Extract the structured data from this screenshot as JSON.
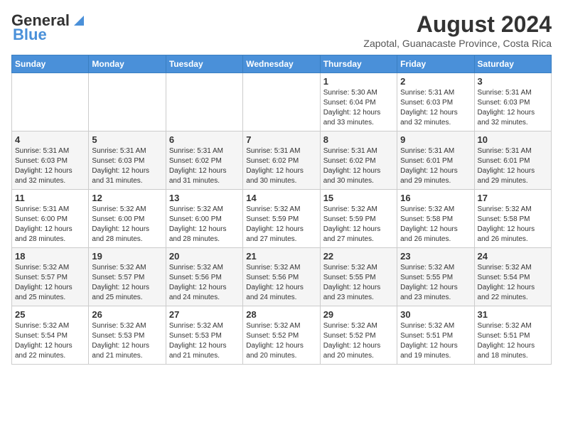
{
  "logo": {
    "line1": "General",
    "line2": "Blue"
  },
  "title": "August 2024",
  "subtitle": "Zapotal, Guanacaste Province, Costa Rica",
  "days_of_week": [
    "Sunday",
    "Monday",
    "Tuesday",
    "Wednesday",
    "Thursday",
    "Friday",
    "Saturday"
  ],
  "weeks": [
    [
      {
        "day": "",
        "info": ""
      },
      {
        "day": "",
        "info": ""
      },
      {
        "day": "",
        "info": ""
      },
      {
        "day": "",
        "info": ""
      },
      {
        "day": "1",
        "info": "Sunrise: 5:30 AM\nSunset: 6:04 PM\nDaylight: 12 hours\nand 33 minutes."
      },
      {
        "day": "2",
        "info": "Sunrise: 5:31 AM\nSunset: 6:03 PM\nDaylight: 12 hours\nand 32 minutes."
      },
      {
        "day": "3",
        "info": "Sunrise: 5:31 AM\nSunset: 6:03 PM\nDaylight: 12 hours\nand 32 minutes."
      }
    ],
    [
      {
        "day": "4",
        "info": "Sunrise: 5:31 AM\nSunset: 6:03 PM\nDaylight: 12 hours\nand 32 minutes."
      },
      {
        "day": "5",
        "info": "Sunrise: 5:31 AM\nSunset: 6:03 PM\nDaylight: 12 hours\nand 31 minutes."
      },
      {
        "day": "6",
        "info": "Sunrise: 5:31 AM\nSunset: 6:02 PM\nDaylight: 12 hours\nand 31 minutes."
      },
      {
        "day": "7",
        "info": "Sunrise: 5:31 AM\nSunset: 6:02 PM\nDaylight: 12 hours\nand 30 minutes."
      },
      {
        "day": "8",
        "info": "Sunrise: 5:31 AM\nSunset: 6:02 PM\nDaylight: 12 hours\nand 30 minutes."
      },
      {
        "day": "9",
        "info": "Sunrise: 5:31 AM\nSunset: 6:01 PM\nDaylight: 12 hours\nand 29 minutes."
      },
      {
        "day": "10",
        "info": "Sunrise: 5:31 AM\nSunset: 6:01 PM\nDaylight: 12 hours\nand 29 minutes."
      }
    ],
    [
      {
        "day": "11",
        "info": "Sunrise: 5:31 AM\nSunset: 6:00 PM\nDaylight: 12 hours\nand 28 minutes."
      },
      {
        "day": "12",
        "info": "Sunrise: 5:32 AM\nSunset: 6:00 PM\nDaylight: 12 hours\nand 28 minutes."
      },
      {
        "day": "13",
        "info": "Sunrise: 5:32 AM\nSunset: 6:00 PM\nDaylight: 12 hours\nand 28 minutes."
      },
      {
        "day": "14",
        "info": "Sunrise: 5:32 AM\nSunset: 5:59 PM\nDaylight: 12 hours\nand 27 minutes."
      },
      {
        "day": "15",
        "info": "Sunrise: 5:32 AM\nSunset: 5:59 PM\nDaylight: 12 hours\nand 27 minutes."
      },
      {
        "day": "16",
        "info": "Sunrise: 5:32 AM\nSunset: 5:58 PM\nDaylight: 12 hours\nand 26 minutes."
      },
      {
        "day": "17",
        "info": "Sunrise: 5:32 AM\nSunset: 5:58 PM\nDaylight: 12 hours\nand 26 minutes."
      }
    ],
    [
      {
        "day": "18",
        "info": "Sunrise: 5:32 AM\nSunset: 5:57 PM\nDaylight: 12 hours\nand 25 minutes."
      },
      {
        "day": "19",
        "info": "Sunrise: 5:32 AM\nSunset: 5:57 PM\nDaylight: 12 hours\nand 25 minutes."
      },
      {
        "day": "20",
        "info": "Sunrise: 5:32 AM\nSunset: 5:56 PM\nDaylight: 12 hours\nand 24 minutes."
      },
      {
        "day": "21",
        "info": "Sunrise: 5:32 AM\nSunset: 5:56 PM\nDaylight: 12 hours\nand 24 minutes."
      },
      {
        "day": "22",
        "info": "Sunrise: 5:32 AM\nSunset: 5:55 PM\nDaylight: 12 hours\nand 23 minutes."
      },
      {
        "day": "23",
        "info": "Sunrise: 5:32 AM\nSunset: 5:55 PM\nDaylight: 12 hours\nand 23 minutes."
      },
      {
        "day": "24",
        "info": "Sunrise: 5:32 AM\nSunset: 5:54 PM\nDaylight: 12 hours\nand 22 minutes."
      }
    ],
    [
      {
        "day": "25",
        "info": "Sunrise: 5:32 AM\nSunset: 5:54 PM\nDaylight: 12 hours\nand 22 minutes."
      },
      {
        "day": "26",
        "info": "Sunrise: 5:32 AM\nSunset: 5:53 PM\nDaylight: 12 hours\nand 21 minutes."
      },
      {
        "day": "27",
        "info": "Sunrise: 5:32 AM\nSunset: 5:53 PM\nDaylight: 12 hours\nand 21 minutes."
      },
      {
        "day": "28",
        "info": "Sunrise: 5:32 AM\nSunset: 5:52 PM\nDaylight: 12 hours\nand 20 minutes."
      },
      {
        "day": "29",
        "info": "Sunrise: 5:32 AM\nSunset: 5:52 PM\nDaylight: 12 hours\nand 20 minutes."
      },
      {
        "day": "30",
        "info": "Sunrise: 5:32 AM\nSunset: 5:51 PM\nDaylight: 12 hours\nand 19 minutes."
      },
      {
        "day": "31",
        "info": "Sunrise: 5:32 AM\nSunset: 5:51 PM\nDaylight: 12 hours\nand 18 minutes."
      }
    ]
  ]
}
